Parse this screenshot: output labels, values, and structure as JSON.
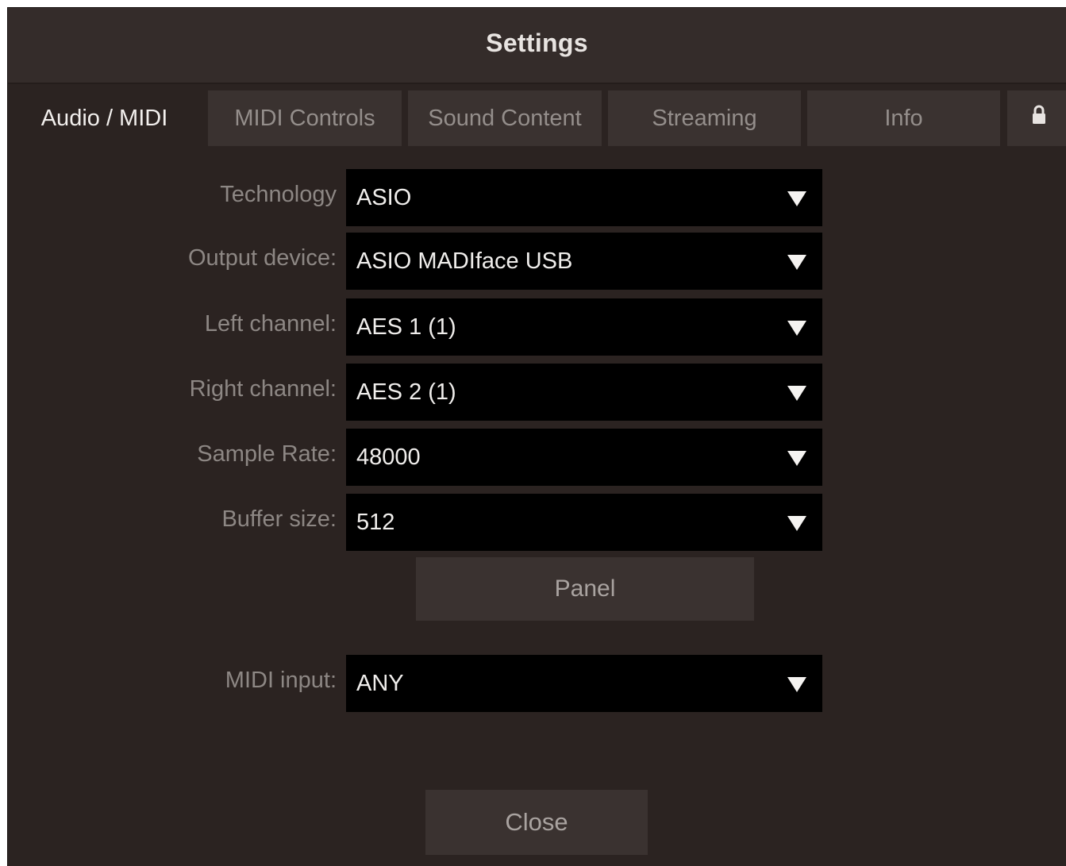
{
  "window": {
    "title": "Settings"
  },
  "tabs": [
    {
      "label": "Audio / MIDI",
      "active": true
    },
    {
      "label": "MIDI Controls",
      "active": false
    },
    {
      "label": "Sound Content",
      "active": false
    },
    {
      "label": "Streaming",
      "active": false
    },
    {
      "label": "Info",
      "active": false
    },
    {
      "icon": "lock-icon",
      "active": false
    }
  ],
  "form": {
    "technology": {
      "label": "Technology",
      "value": "ASIO"
    },
    "output_device": {
      "label": "Output device:",
      "value": "ASIO MADIface USB"
    },
    "left_channel": {
      "label": "Left channel:",
      "value": "AES 1 (1)"
    },
    "right_channel": {
      "label": "Right channel:",
      "value": "AES 2 (1)"
    },
    "sample_rate": {
      "label": "Sample Rate:",
      "value": "48000"
    },
    "buffer_size": {
      "label": "Buffer size:",
      "value": "512"
    },
    "panel_button": "Panel",
    "midi_input": {
      "label": "MIDI input:",
      "value": "ANY"
    }
  },
  "footer": {
    "close_button": "Close"
  },
  "colors": {
    "background": "#2b2321",
    "titlebar": "#342c2a",
    "tab_inactive": "#3a3230",
    "select_bg": "#000000",
    "text_primary": "#f0eeec",
    "text_muted": "#8d8784"
  }
}
